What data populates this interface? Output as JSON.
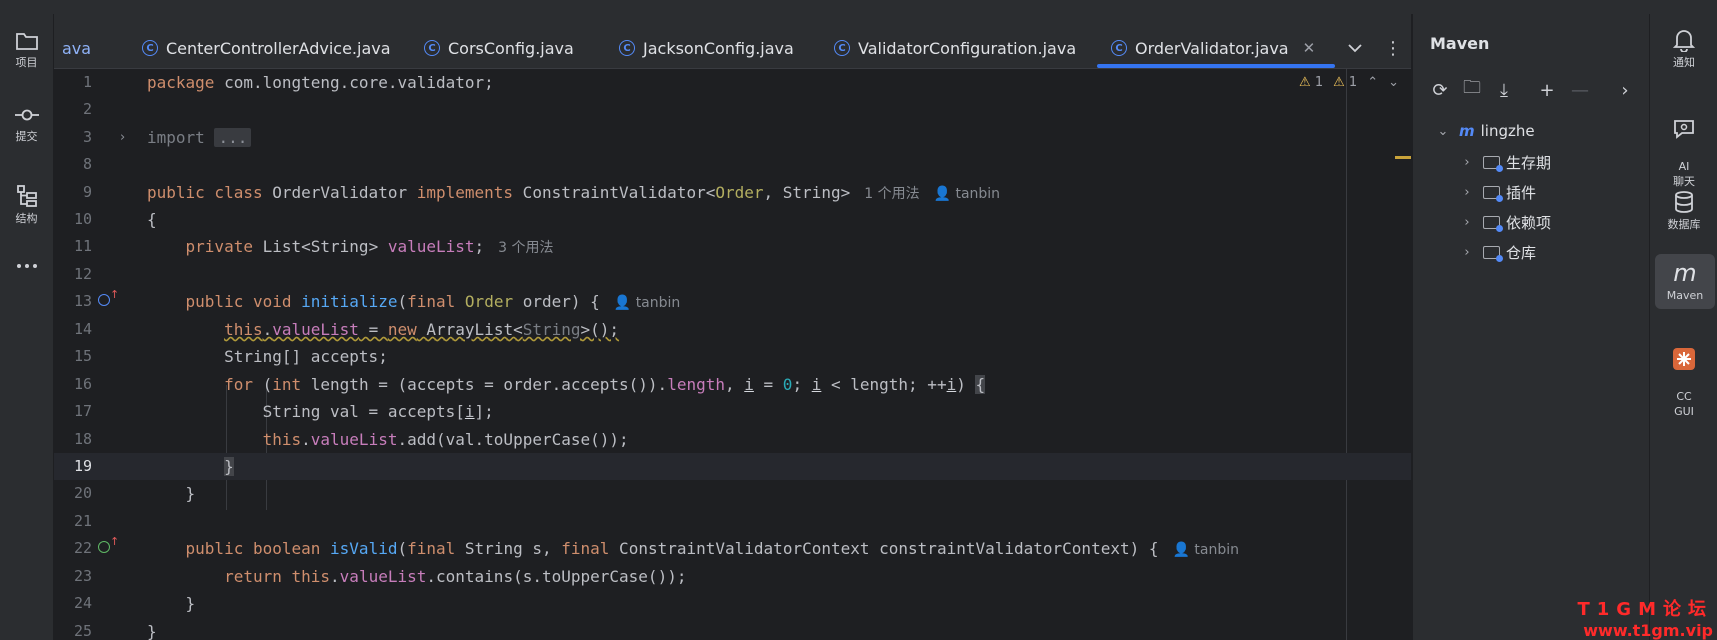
{
  "left_sidebar": [
    {
      "label": "项目",
      "icon": "folder-icon"
    },
    {
      "label": "提交",
      "icon": "commit-icon"
    },
    {
      "label": "结构",
      "icon": "structure-icon"
    },
    {
      "label": "",
      "icon": "more-icon"
    }
  ],
  "tabs": [
    {
      "label": "ava",
      "active": false,
      "partial": true
    },
    {
      "label": "CenterControllerAdvice.java",
      "active": false
    },
    {
      "label": "CorsConfig.java",
      "active": false
    },
    {
      "label": "JacksonConfig.java",
      "active": false
    },
    {
      "label": "ValidatorConfiguration.java",
      "active": false
    },
    {
      "label": "OrderValidator.java",
      "active": true
    }
  ],
  "tab_actions": {
    "dropdown_icon": "chevron-down-icon",
    "menu_icon": "more-vertical-icon"
  },
  "editor": {
    "indicators": {
      "warnings_a": "1",
      "warnings_b": "1"
    },
    "hints": {
      "class_usages": "1 个用法",
      "field_usages": "3 个用法",
      "author_class": "tanbin",
      "author_initialize": "tanbin",
      "author_isvalid": "tanbin"
    },
    "line_numbers": [
      "1",
      "2",
      "3",
      "8",
      "9",
      "10",
      "11",
      "12",
      "13",
      "14",
      "15",
      "16",
      "17",
      "18",
      "19",
      "20",
      "21",
      "22",
      "23",
      "24",
      "25"
    ],
    "current_line": "19"
  },
  "maven": {
    "title": "Maven",
    "root": "lingzhe",
    "children": [
      "生存期",
      "插件",
      "依赖项",
      "仓库"
    ]
  },
  "right_sidebar": [
    {
      "label": "通知",
      "icon": "bell-icon"
    },
    {
      "label": "AI\n聊天",
      "icon": "ai-chat-icon"
    },
    {
      "label": "数据库",
      "icon": "database-icon"
    },
    {
      "label": "Maven",
      "icon": "maven-icon"
    },
    {
      "label": "CC\nGUI",
      "icon": "cc-gui-icon"
    }
  ],
  "watermark": {
    "line1": "T1GM论坛",
    "line2": "www.t1gm.vip"
  }
}
